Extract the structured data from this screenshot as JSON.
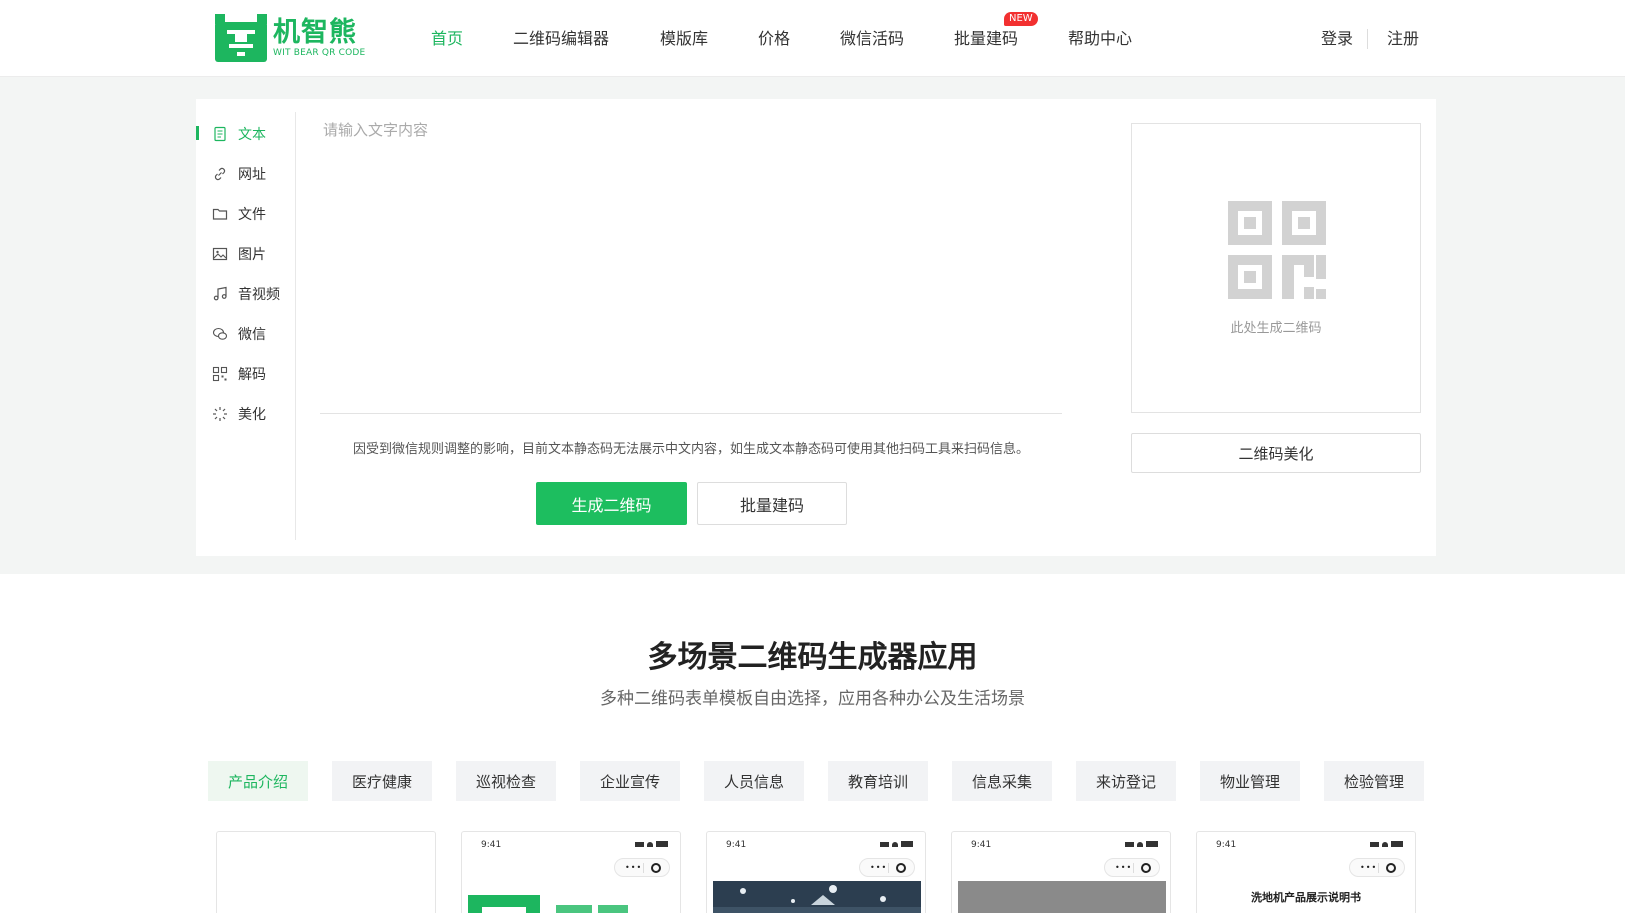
{
  "brand": {
    "name_cn": "机智熊",
    "name_en": "WIT BEAR QR CODE",
    "accent": "#1db65f"
  },
  "nav": [
    {
      "label": "首页",
      "active": true
    },
    {
      "label": "二维码编辑器"
    },
    {
      "label": "模版库"
    },
    {
      "label": "价格"
    },
    {
      "label": "微信活码"
    },
    {
      "label": "批量建码",
      "badge": "NEW"
    },
    {
      "label": "帮助中心"
    }
  ],
  "auth": {
    "login": "登录",
    "register": "注册"
  },
  "sidebar": [
    {
      "label": "文本",
      "icon": "document-icon",
      "active": true
    },
    {
      "label": "网址",
      "icon": "link-icon"
    },
    {
      "label": "文件",
      "icon": "folder-icon"
    },
    {
      "label": "图片",
      "icon": "image-icon"
    },
    {
      "label": "音视频",
      "icon": "music-icon"
    },
    {
      "label": "微信",
      "icon": "wechat-icon"
    },
    {
      "label": "解码",
      "icon": "grid-icon"
    },
    {
      "label": "美化",
      "icon": "sparkle-icon"
    }
  ],
  "editor": {
    "placeholder": "请输入文字内容",
    "notice": "因受到微信规则调整的影响，目前文本静态码无法展示中文内容，如生成文本静态码可使用其他扫码工具来扫码信息。",
    "generate_label": "生成二维码",
    "batch_label": "批量建码"
  },
  "preview": {
    "hint": "此处生成二维码",
    "beautify_label": "二维码美化"
  },
  "scenarios": {
    "title": "多场景二维码生成器应用",
    "subtitle": "多种二维码表单模板自由选择，应用各种办公及生活场景",
    "tags": [
      "产品介绍",
      "医疗健康",
      "巡视检查",
      "企业宣传",
      "人员信息",
      "教育培训",
      "信息采集",
      "来访登记",
      "物业管理",
      "检验管理"
    ],
    "active_tag": 0
  },
  "cards": [
    {
      "time": "",
      "title": ""
    },
    {
      "time": "9:41",
      "title": ""
    },
    {
      "time": "9:41",
      "title": ""
    },
    {
      "time": "9:41",
      "title": ""
    },
    {
      "time": "9:41",
      "title": "洗地机产品展示说明书"
    }
  ]
}
